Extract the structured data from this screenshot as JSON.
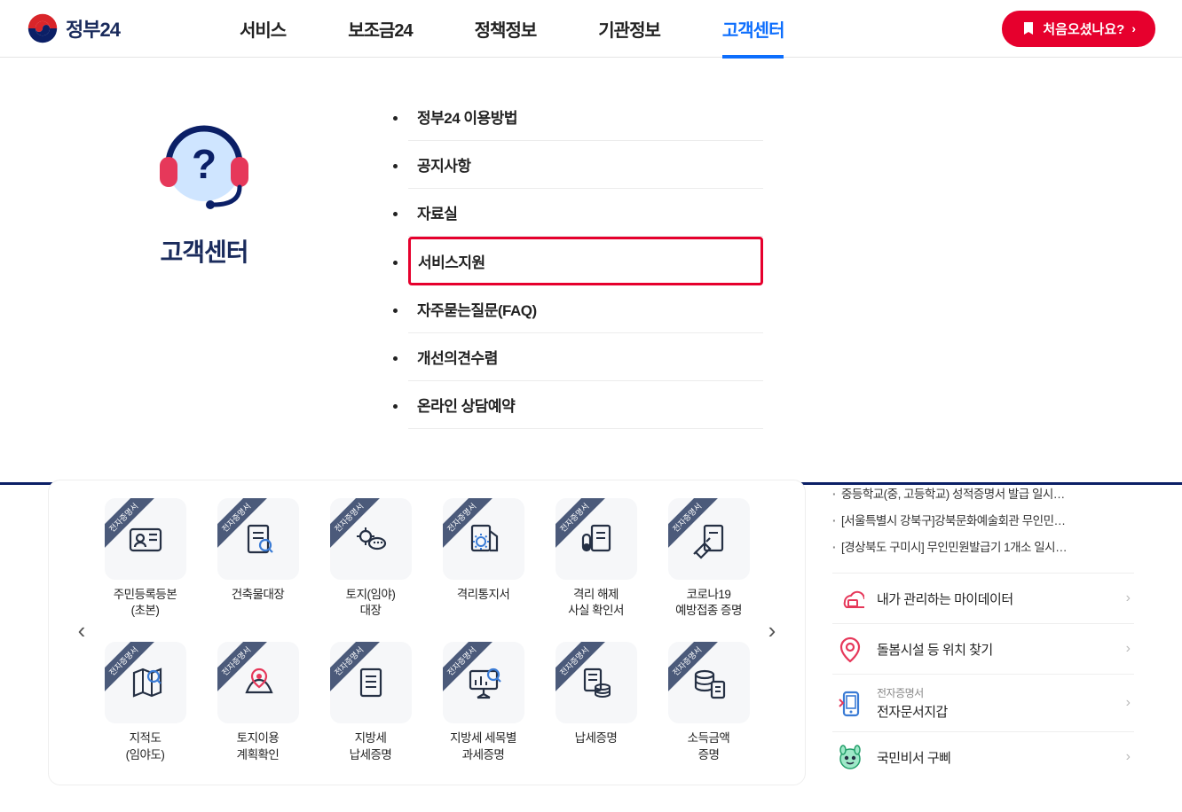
{
  "brand": "정부24",
  "nav": [
    "서비스",
    "보조금24",
    "정책정보",
    "기관정보",
    "고객센터"
  ],
  "nav_active_index": 4,
  "header_button": "처음오셨나요?",
  "mega": {
    "title": "고객센터",
    "items": [
      "정부24 이용방법",
      "공지사항",
      "자료실",
      "서비스지원",
      "자주묻는질문(FAQ)",
      "개선의견수렴",
      "온라인 상담예약"
    ],
    "highlight_index": 3
  },
  "ribbon_label": "전자증명서",
  "services": [
    {
      "label": "주민등록등본\n(초본)",
      "icon": "id-card"
    },
    {
      "label": "건축물대장",
      "icon": "receipt"
    },
    {
      "label": "토지(임야)\n대장",
      "icon": "land"
    },
    {
      "label": "격리통지서",
      "icon": "virus-doc"
    },
    {
      "label": "격리 해제\n사실 확인서",
      "icon": "vial-doc"
    },
    {
      "label": "코로나19\n예방접종 증명",
      "icon": "syringe"
    },
    {
      "label": "지적도\n(임야도)",
      "icon": "map-search"
    },
    {
      "label": "토지이용\n계획확인",
      "icon": "map-pin"
    },
    {
      "label": "지방세\n납세증명",
      "icon": "doc-lines"
    },
    {
      "label": "지방세 세목별\n과세증명",
      "icon": "presentation"
    },
    {
      "label": "납세증명",
      "icon": "doc-db"
    },
    {
      "label": "소득금액\n증명",
      "icon": "db-doc"
    }
  ],
  "notices": [
    "중등학교(중, 고등학교) 성적증명서 발급 일시…",
    "[서울특별시 강북구]강북문화예술회관 무인민…",
    "[경상북도 구미시] 무인민원발급기 1개소 일시…"
  ],
  "quick": [
    {
      "sub": "",
      "title": "내가 관리하는 마이데이터",
      "icon": "cloud"
    },
    {
      "sub": "",
      "title": "돌봄시설 등 위치 찾기",
      "icon": "pin"
    },
    {
      "sub": "전자증명서",
      "title": "전자문서지갑",
      "icon": "phone"
    },
    {
      "sub": "",
      "title": "국민비서 구삐",
      "icon": "mascot"
    }
  ]
}
